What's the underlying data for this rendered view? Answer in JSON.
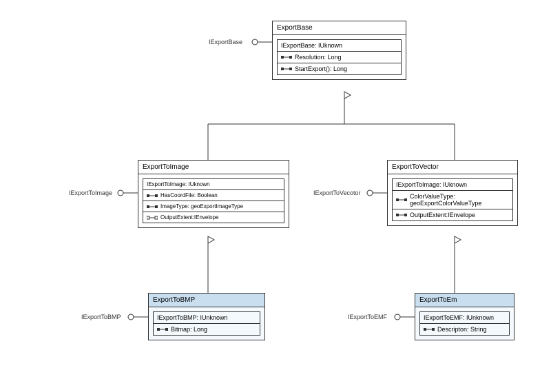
{
  "classes": {
    "exportBase": {
      "title": "ExportBase",
      "iface": "IExportBase: IUknown",
      "members": [
        "Resolution: Long",
        "StartExport(): Long"
      ],
      "label": "IExportBase"
    },
    "exportToImage": {
      "title": "ExportToImage",
      "iface": "IExportToImage: IUknown",
      "members": [
        "HasCoordFile: Boolean",
        "ImageType: geoExportImageType",
        "OutputExtent:IEnvelope"
      ],
      "label": "IExportToImage"
    },
    "exportToVector": {
      "title": "ExportToVector",
      "iface": "IExportToImage: IUknown",
      "members": [
        "ColorValueType: geoExportColorValueType",
        "OutputExtent:IEnvelope"
      ],
      "label": "IExportToVecotor"
    },
    "exportToBMP": {
      "title": "ExportToBMP",
      "iface": "IExportToBMP: IUnknown",
      "members": [
        "Bitmap: Long"
      ],
      "label": "IExportToBMP"
    },
    "exportToEm": {
      "title": "ExportToEm",
      "iface": "IExportToEMF: IUnknown",
      "members": [
        "Descripton: String"
      ],
      "label": "IExportToEMF"
    }
  },
  "chart_data": {
    "type": "uml-class-diagram",
    "classes": [
      {
        "name": "ExportBase",
        "stereotype": "abstract",
        "provides": [
          "IExportBase"
        ],
        "compartments": [
          {
            "header": "IExportBase: IUknown",
            "members": [
              {
                "name": "Resolution",
                "type": "Long",
                "kind": "property",
                "rw": "rw"
              },
              {
                "name": "StartExport()",
                "type": "Long",
                "kind": "method",
                "rw": "rw"
              }
            ]
          }
        ]
      },
      {
        "name": "ExportToImage",
        "stereotype": "abstract",
        "extends": "ExportBase",
        "provides": [
          "IExportToImage"
        ],
        "compartments": [
          {
            "header": "IExportToImage: IUknown",
            "members": [
              {
                "name": "HasCoordFile",
                "type": "Boolean",
                "kind": "property",
                "rw": "rw"
              },
              {
                "name": "ImageType",
                "type": "geoExportImageType",
                "kind": "property",
                "rw": "rw"
              },
              {
                "name": "OutputExtent",
                "type": "IEnvelope",
                "kind": "property",
                "rw": "ro"
              }
            ]
          }
        ]
      },
      {
        "name": "ExportToVector",
        "stereotype": "abstract",
        "extends": "ExportBase",
        "provides": [
          "IExportToVecotor"
        ],
        "compartments": [
          {
            "header": "IExportToImage: IUknown",
            "members": [
              {
                "name": "ColorValueType",
                "type": "geoExportColorValueType",
                "kind": "property",
                "rw": "rw"
              },
              {
                "name": "OutputExtent",
                "type": "IEnvelope",
                "kind": "property",
                "rw": "rw"
              }
            ]
          }
        ]
      },
      {
        "name": "ExportToBMP",
        "stereotype": "concrete",
        "extends": "ExportToImage",
        "provides": [
          "IExportToBMP"
        ],
        "compartments": [
          {
            "header": "IExportToBMP: IUnknown",
            "members": [
              {
                "name": "Bitmap",
                "type": "Long",
                "kind": "property",
                "rw": "rw"
              }
            ]
          }
        ]
      },
      {
        "name": "ExportToEm",
        "stereotype": "concrete",
        "extends": "ExportToVector",
        "provides": [
          "IExportToEMF"
        ],
        "compartments": [
          {
            "header": "IExportToEMF: IUnknown",
            "members": [
              {
                "name": "Descripton",
                "type": "String",
                "kind": "property",
                "rw": "rw"
              }
            ]
          }
        ]
      }
    ],
    "relations": [
      {
        "from": "ExportToImage",
        "to": "ExportBase",
        "type": "generalization"
      },
      {
        "from": "ExportToVector",
        "to": "ExportBase",
        "type": "generalization"
      },
      {
        "from": "ExportToBMP",
        "to": "ExportToImage",
        "type": "generalization"
      },
      {
        "from": "ExportToEm",
        "to": "ExportToVector",
        "type": "generalization"
      }
    ]
  }
}
